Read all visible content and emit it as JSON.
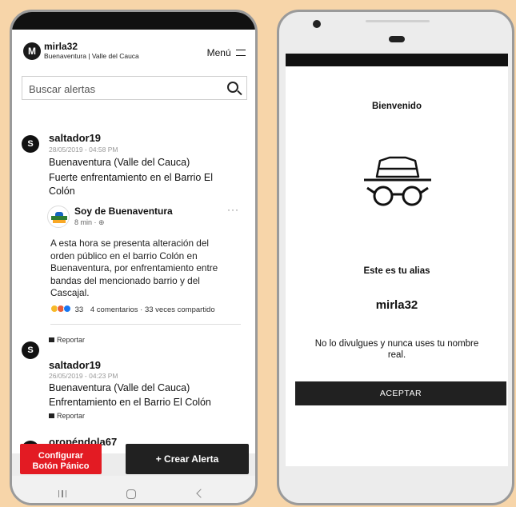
{
  "left_screen": {
    "user": {
      "avatar_letter": "M",
      "name": "mirla32",
      "location": "Buenaventura | Valle del Cauca"
    },
    "menu_label": "Menú",
    "search": {
      "placeholder": "Buscar alertas"
    },
    "posts": [
      {
        "avatar_letter": "S",
        "user": "saltador19",
        "date": "28/05/2019 - 04:58 PM",
        "location": "Buenaventura (Valle del Cauca)",
        "text_lines": [
          "Fuerte enfrentamiento en el Barrio El",
          "Colón"
        ],
        "embed": {
          "source": "Soy de Buenaventura",
          "time": "8 min · ⊕",
          "more": "···",
          "text_lines": [
            "A esta hora se presenta alteración del",
            "orden público en el barrio Colón en",
            "Buenaventura, por enfrentamiento entre",
            "bandas del mencionado barrio y del",
            "Cascajal."
          ],
          "reactions": "33",
          "comments": "4 comentarios · 33 veces compartido"
        },
        "report": "Reportar"
      },
      {
        "avatar_letter": "S",
        "user": "saltador19",
        "date": "26/05/2019 - 04:23 PM",
        "location": "Buenaventura (Valle del Cauca)",
        "text_lines": [
          "Enfrentamiento en el Barrio El Colón"
        ],
        "report": "Reportar"
      }
    ],
    "next_user_peek": "oropéndola67",
    "panic_button": {
      "line1": "Configurar",
      "line2": "Botón Pánico"
    },
    "create_button": "+ Crear Alerta"
  },
  "right_screen": {
    "welcome": "Bienvenido",
    "alias_title": "Este es tu alias",
    "alias_value": "mirla32",
    "alias_note": "No lo divulgues y nunca uses tu nombre real.",
    "accept_button": "ACEPTAR"
  },
  "icons": {
    "menu": "hamburger-icon",
    "search": "search-icon",
    "spy": "incognito-hat-glasses-icon",
    "flag": "flag-icon",
    "nav_recent": "recent-apps-icon",
    "nav_home": "home-icon",
    "nav_back": "back-icon"
  },
  "colors": {
    "background": "#f7d5a9",
    "panic": "#e31b23",
    "dark_button": "#212121"
  }
}
